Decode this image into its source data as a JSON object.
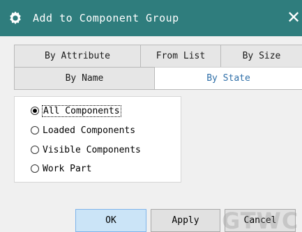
{
  "window": {
    "title": "Add to Component Group",
    "close_glyph": "✕",
    "gear_icon": "gear-icon",
    "titlebar_color": "#2f7d7d"
  },
  "tabs": {
    "row1": [
      "By Attribute",
      "From List",
      "By Size"
    ],
    "row2": [
      "By Name",
      "By State"
    ],
    "active": "By State"
  },
  "options": [
    {
      "label": "All Components",
      "selected": true
    },
    {
      "label": "Loaded Components",
      "selected": false
    },
    {
      "label": "Visible Components",
      "selected": false
    },
    {
      "label": "Work Part",
      "selected": false
    }
  ],
  "buttons": {
    "ok": "OK",
    "apply": "Apply",
    "cancel": "Cancel"
  },
  "watermark": "GTWC"
}
